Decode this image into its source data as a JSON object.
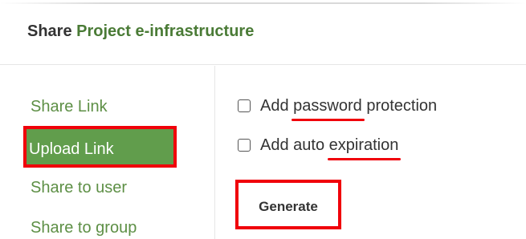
{
  "dialog": {
    "title_prefix": "Share",
    "project_name": "Project e-infrastructure"
  },
  "sidebar": {
    "items": [
      {
        "label": "Share Link"
      },
      {
        "label": "Upload Link"
      },
      {
        "label": "Share to user"
      },
      {
        "label": "Share to group"
      }
    ]
  },
  "options": {
    "password": {
      "before": "Add ",
      "underlined": "password",
      "after": " protection",
      "checked": false
    },
    "expiration": {
      "before": "Add auto ",
      "underlined": "expiration",
      "after": "",
      "checked": false
    }
  },
  "generate_label": "Generate",
  "colors": {
    "accent_green": "#619d4c",
    "link_green": "#5d8f45",
    "highlight_red": "#f0000a"
  }
}
